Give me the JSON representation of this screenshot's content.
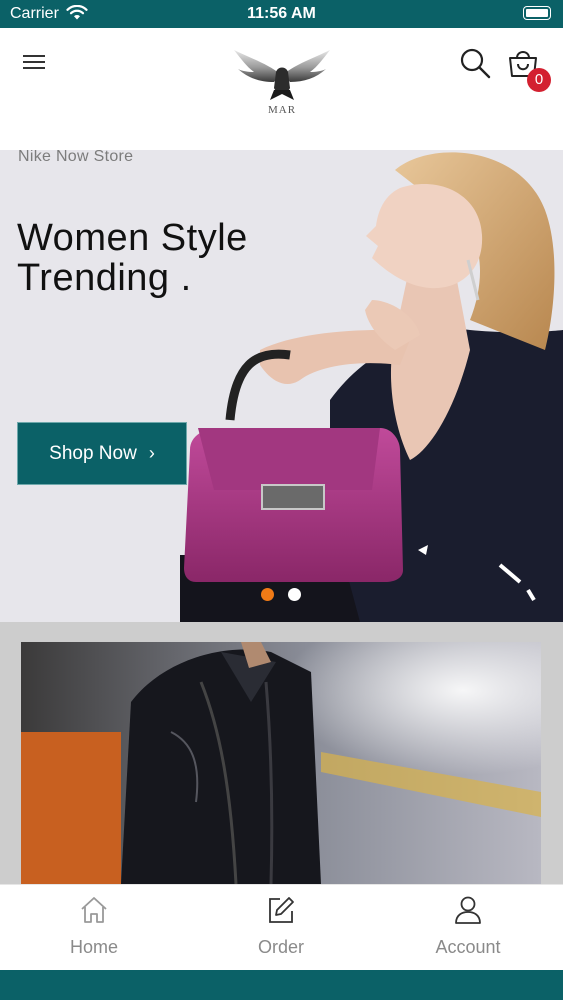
{
  "status_bar": {
    "carrier": "Carrier",
    "time": "11:56 AM"
  },
  "header": {
    "logo_text": "MAR",
    "cart_count": "0"
  },
  "banner": {
    "tag": "Nike Now Store",
    "title_line1": "Women Style",
    "title_line2": "Trending .",
    "button_label": "Shop Now",
    "button_icon": "chevron-right-icon",
    "slide_count": 2,
    "active_slide": 1
  },
  "nav": {
    "items": [
      {
        "label": "Home",
        "icon": "home-icon"
      },
      {
        "label": "Order",
        "icon": "edit-icon"
      },
      {
        "label": "Account",
        "icon": "user-icon"
      }
    ]
  },
  "colors": {
    "brand": "#0b6167",
    "badge": "#d32030",
    "active_dot": "#f07a16",
    "inactive_dot": "#ffffff"
  }
}
